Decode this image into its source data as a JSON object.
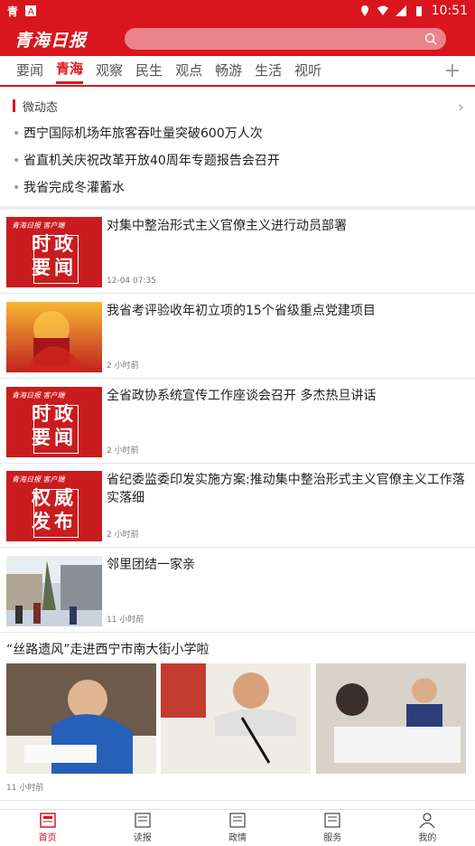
{
  "status_bar": {
    "time": "10:51"
  },
  "header": {
    "logo_text": "青海日报",
    "search_placeholder": ""
  },
  "tabs": [
    "要闻",
    "青海",
    "观察",
    "民生",
    "观点",
    "畅游",
    "生活",
    "视听"
  ],
  "active_tab": "青海",
  "micro_news": {
    "title": "微动态",
    "items": [
      "西宁国际机场年旅客吞吐量突破600万人次",
      "省直机关庆祝改革开放40周年专题报告会召开",
      "我省完成冬灌蓄水"
    ]
  },
  "news": [
    {
      "title": "对集中整治形式主义官僚主义进行动员部署",
      "time": "12-04 07:35",
      "thumb": "时政要闻",
      "thumb_brand": "青海日报 客户端"
    },
    {
      "title": "我省考评验收年初立项的15个省级重点党建项目",
      "time": "2 小时前",
      "thumb": "party-photo"
    },
    {
      "title": "全省政协系统宣传工作座谈会召开 多杰热旦讲话",
      "time": "2 小时前",
      "thumb": "时政要闻",
      "thumb_brand": "青海日报 客户端"
    },
    {
      "title": "省纪委监委印发实施方案:推动集中整治形式主义官僚主义工作落实落细",
      "time": "2 小时前",
      "thumb": "权威发布",
      "thumb_brand": "青海日报 客户端"
    },
    {
      "title": "邻里团结一家亲",
      "time": "11 小时前",
      "thumb": "street-photo"
    }
  ],
  "gallery": {
    "title": "“丝路遗风”走进西宁市南大街小学啦",
    "time": "11 小时前"
  },
  "bottom_nav": [
    {
      "label": "首页",
      "active": true
    },
    {
      "label": "读报",
      "active": false
    },
    {
      "label": "政情",
      "active": false
    },
    {
      "label": "服务",
      "active": false
    },
    {
      "label": "我的",
      "active": false
    }
  ],
  "colors": {
    "brand": "#d9161d"
  }
}
